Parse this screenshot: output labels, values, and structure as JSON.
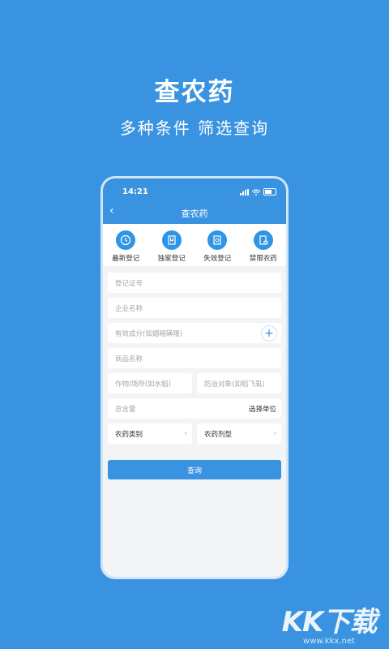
{
  "hero": {
    "title": "查农药",
    "subtitle": "多种条件 筛选查询"
  },
  "status_bar": {
    "time": "14:21"
  },
  "nav": {
    "back_glyph": "‹",
    "title": "查农药"
  },
  "quick_actions": [
    {
      "label": "最新登记",
      "icon": "clock-icon"
    },
    {
      "label": "独家登记",
      "icon": "document-bookmark-icon"
    },
    {
      "label": "失效登记",
      "icon": "document-search-icon"
    },
    {
      "label": "禁限农药",
      "icon": "document-forbidden-icon"
    }
  ],
  "form": {
    "registration_no": "登记证号",
    "company_name": "企业名称",
    "active_ingredient": "有效成分(如烟嘧磺隆)",
    "product_name": "商品名称",
    "crop_site": "作物/场所(如水稻)",
    "target": "防治对象(如稻飞虱)",
    "total_content": "总含量",
    "unit_label": "选择单位",
    "pesticide_category": "农药类别",
    "formulation": "农药剂型",
    "chevron": "›",
    "plus": "+"
  },
  "query_button": "查询",
  "watermark": {
    "brand": "KK下载",
    "url": "www.kkx.net"
  },
  "colors": {
    "background": "#3a93e0",
    "accent": "#2f95e6",
    "screen_bg": "#f3f4f6"
  }
}
